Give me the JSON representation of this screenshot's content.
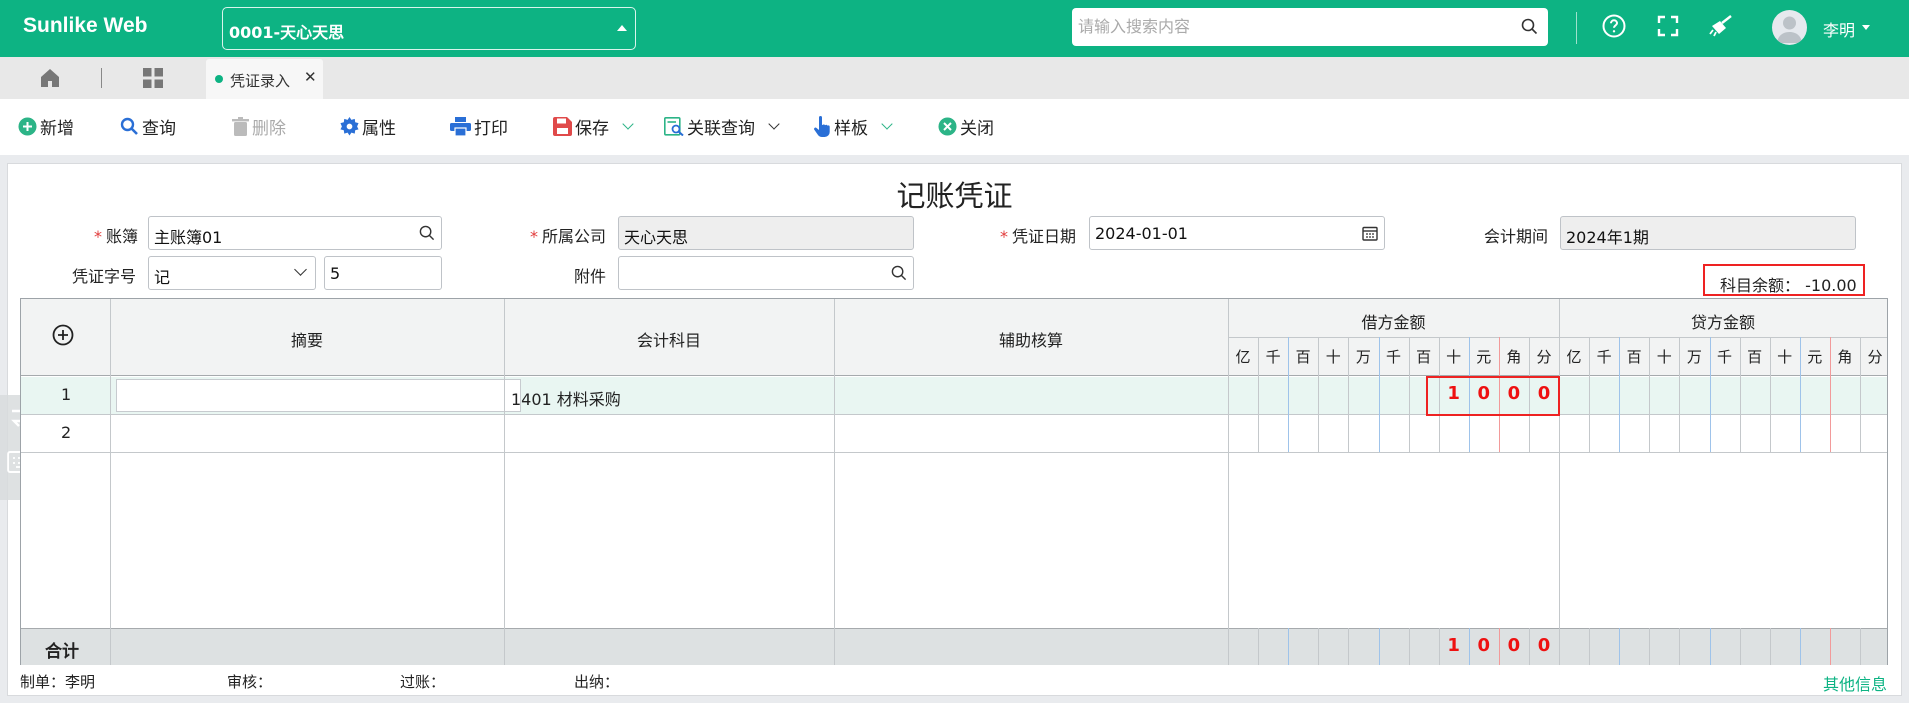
{
  "app": {
    "brand": "Sunlike Web"
  },
  "header": {
    "org_selector": "0001-天心天思",
    "search_placeholder": "请输入搜索内容",
    "user_name": "李明"
  },
  "tabs": [
    {
      "label": "凭证录入",
      "active": true
    }
  ],
  "toolbar": {
    "new": "新增",
    "query": "查询",
    "delete": "删除",
    "properties": "属性",
    "print": "打印",
    "save": "保存",
    "related_query": "关联查询",
    "template": "样板",
    "close": "关闭"
  },
  "form": {
    "title": "记账凭证",
    "ledger_label": "账簿",
    "ledger_value": "主账簿01",
    "company_label": "所属公司",
    "company_value": "天心天思",
    "date_label": "凭证日期",
    "date_value": "2024-01-01",
    "period_label": "会计期间",
    "period_value": "2024年1期",
    "voucher_type_label": "凭证字号",
    "voucher_type_value": "记",
    "voucher_number": "5",
    "attachment_label": "附件",
    "attachment_value": "",
    "balance_label": "科目余额：",
    "balance_value": "-10.00"
  },
  "table": {
    "columns": {
      "summary": "摘要",
      "subject": "会计科目",
      "auxiliary": "辅助核算",
      "debit": "借方金额",
      "credit": "贷方金额"
    },
    "digit_units": [
      "亿",
      "千",
      "百",
      "十",
      "万",
      "千",
      "百",
      "十",
      "元",
      "角",
      "分"
    ],
    "rows": [
      {
        "no": "1",
        "summary": "",
        "subject": "1401 材料采购",
        "auxiliary": "",
        "debit_digits": [
          "",
          "",
          "",
          "",
          "",
          "",
          "",
          "1",
          "0",
          "0",
          "0"
        ],
        "credit_digits": [
          "",
          "",
          "",
          "",
          "",
          "",
          "",
          "",
          "",
          "",
          ""
        ]
      },
      {
        "no": "2",
        "summary": "",
        "subject": "",
        "auxiliary": "",
        "debit_digits": [
          "",
          "",
          "",
          "",
          "",
          "",
          "",
          "",
          "",
          "",
          ""
        ],
        "credit_digits": [
          "",
          "",
          "",
          "",
          "",
          "",
          "",
          "",
          "",
          "",
          ""
        ]
      }
    ],
    "total_label": "合计",
    "total_debit_digits": [
      "",
      "",
      "",
      "",
      "",
      "",
      "",
      "1",
      "0",
      "0",
      "0"
    ],
    "total_credit_digits": [
      "",
      "",
      "",
      "",
      "",
      "",
      "",
      "",
      "",
      "",
      ""
    ]
  },
  "footer": {
    "maker_label": "制单：",
    "maker_value": "李明",
    "reviewer_label": "审核：",
    "poster_label": "过账：",
    "cashier_label": "出纳：",
    "other_info": "其他信息"
  },
  "colors": {
    "brand": "#0db383",
    "highlight": "#e22222"
  }
}
